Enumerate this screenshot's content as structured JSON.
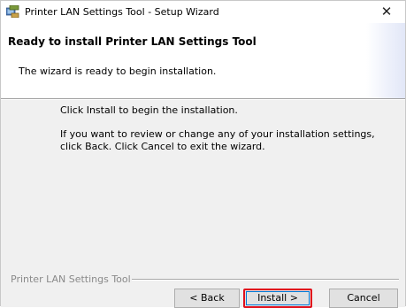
{
  "window": {
    "title": "Printer LAN Settings Tool - Setup Wizard",
    "close_glyph": "✕",
    "icon": "installer-icon"
  },
  "banner": {
    "heading": "Ready to install Printer LAN Settings Tool",
    "subheading": "The wizard is ready to begin installation."
  },
  "body": {
    "line1": "Click Install to begin the installation.",
    "line2": "If you want to review or change any of your installation settings, click Back. Click Cancel to exit the wizard."
  },
  "footer": {
    "brand": "Printer LAN Settings Tool",
    "back_label": "< Back",
    "install_label": "Install >",
    "cancel_label": "Cancel"
  },
  "colors": {
    "highlight_border": "#e0101c",
    "focus_border": "#0078d7",
    "dialog_bg": "#f0f0f0"
  }
}
